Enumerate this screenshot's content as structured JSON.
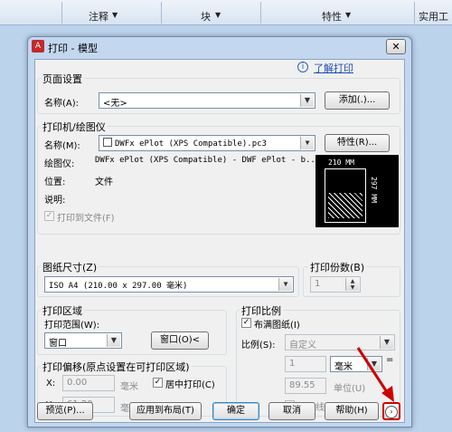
{
  "ribbon": {
    "group1": "注释",
    "group2": "块",
    "group3": "特性",
    "group4": "实用工"
  },
  "dialog": {
    "title": "打印 - 模型",
    "help_link": "了解打印",
    "page_setup": {
      "group_label": "页面设置",
      "name_label": "名称(A):",
      "name_value": "<无>",
      "add_button": "添加(.)..."
    },
    "printer": {
      "group_label": "打印机/绘图仪",
      "name_label": "名称(M):",
      "name_value": "DWFx ePlot (XPS Compatible).pc3",
      "properties_button": "特性(R)...",
      "plotter_label": "绘图仪:",
      "plotter_value": "DWFx ePlot (XPS Compatible) - DWF ePlot - b...",
      "location_label": "位置:",
      "location_value": "文件",
      "description_label": "说明:",
      "plot_to_file": "打印到文件(F)",
      "preview_width": "210 MM",
      "preview_height": "297 MM"
    },
    "paper_size": {
      "group_label": "图纸尺寸(Z)",
      "value": "ISO A4 (210.00 x 297.00 毫米)"
    },
    "copies": {
      "group_label": "打印份数(B)",
      "value": "1"
    },
    "plot_area": {
      "group_label": "打印区域",
      "range_label": "打印范围(W):",
      "range_value": "窗口",
      "window_button": "窗口(O)<"
    },
    "plot_offset": {
      "group_label": "打印偏移(原点设置在可打印区域)",
      "x_label": "X:",
      "x_value": "0.00",
      "x_unit": "毫米",
      "y_label": "Y:",
      "y_value": "61.20",
      "y_unit": "毫米",
      "center_label": "居中打印(C)"
    },
    "plot_scale": {
      "group_label": "打印比例",
      "fit_label": "布满图纸(I)",
      "scale_label": "比例(S):",
      "scale_value": "自定义",
      "value1": "1",
      "unit_value": "毫米",
      "equals": "=",
      "value2": "89.55",
      "unit_label": "单位(U)",
      "lineweights_label": "缩放线宽(L)"
    },
    "buttons": {
      "preview": "预览(P)...",
      "apply_layout": "应用到布局(T)",
      "ok": "确定",
      "cancel": "取消",
      "help": "帮助(H)"
    }
  },
  "colors": {
    "annotation_arrow": "#cc0000"
  }
}
